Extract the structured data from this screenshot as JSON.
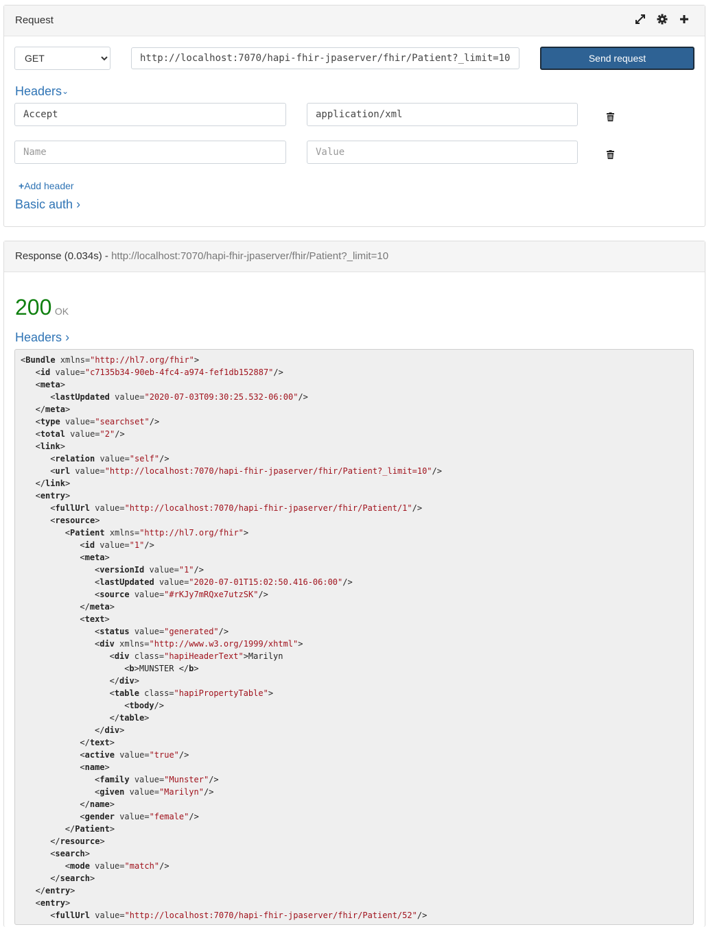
{
  "request": {
    "title": "Request",
    "method": "GET",
    "url": "http://localhost:7070/hapi-fhir-jpaserver/fhir/Patient?_limit=10",
    "send_label": "Send request",
    "headers_label": "Headers",
    "headers": [
      {
        "name": "Accept",
        "value": "application/xml"
      }
    ],
    "name_placeholder": "Name",
    "value_placeholder": "Value",
    "add_header_label": "Add header",
    "basic_auth_label": "Basic auth",
    "icons": [
      "expand-icon",
      "gear-icon",
      "plus-icon"
    ]
  },
  "response": {
    "title": "Response (0.034s) - ",
    "url": "http://localhost:7070/hapi-fhir-jpaserver/fhir/Patient?_limit=10",
    "status_code": "200",
    "status_text": "OK",
    "headers_label": "Headers",
    "status_color": "#108010",
    "body_lines": [
      [
        0,
        "Bundle",
        [
          [
            "xmlns",
            "http://hl7.org/fhir"
          ]
        ],
        "open",
        ""
      ],
      [
        1,
        "id",
        [
          [
            "value",
            "c7135b34-90eb-4fc4-a974-fef1db152887"
          ]
        ],
        "self",
        ""
      ],
      [
        1,
        "meta",
        [],
        "open",
        ""
      ],
      [
        2,
        "lastUpdated",
        [
          [
            "value",
            "2020-07-03T09:30:25.532-06:00"
          ]
        ],
        "self",
        ""
      ],
      [
        1,
        "meta",
        [],
        "close",
        ""
      ],
      [
        1,
        "type",
        [
          [
            "value",
            "searchset"
          ]
        ],
        "self",
        ""
      ],
      [
        1,
        "total",
        [
          [
            "value",
            "2"
          ]
        ],
        "self",
        ""
      ],
      [
        1,
        "link",
        [],
        "open",
        ""
      ],
      [
        2,
        "relation",
        [
          [
            "value",
            "self"
          ]
        ],
        "self",
        ""
      ],
      [
        2,
        "url",
        [
          [
            "value",
            "http://localhost:7070/hapi-fhir-jpaserver/fhir/Patient?_limit=10"
          ]
        ],
        "self",
        ""
      ],
      [
        1,
        "link",
        [],
        "close",
        ""
      ],
      [
        1,
        "entry",
        [],
        "open",
        ""
      ],
      [
        2,
        "fullUrl",
        [
          [
            "value",
            "http://localhost:7070/hapi-fhir-jpaserver/fhir/Patient/1"
          ]
        ],
        "self",
        ""
      ],
      [
        2,
        "resource",
        [],
        "open",
        ""
      ],
      [
        3,
        "Patient",
        [
          [
            "xmlns",
            "http://hl7.org/fhir"
          ]
        ],
        "open",
        ""
      ],
      [
        4,
        "id",
        [
          [
            "value",
            "1"
          ]
        ],
        "self",
        ""
      ],
      [
        4,
        "meta",
        [],
        "open",
        ""
      ],
      [
        5,
        "versionId",
        [
          [
            "value",
            "1"
          ]
        ],
        "self",
        ""
      ],
      [
        5,
        "lastUpdated",
        [
          [
            "value",
            "2020-07-01T15:02:50.416-06:00"
          ]
        ],
        "self",
        ""
      ],
      [
        5,
        "source",
        [
          [
            "value",
            "#rKJy7mRQxe7utzSK"
          ]
        ],
        "self",
        ""
      ],
      [
        4,
        "meta",
        [],
        "close",
        ""
      ],
      [
        4,
        "text",
        [],
        "open",
        ""
      ],
      [
        5,
        "status",
        [
          [
            "value",
            "generated"
          ]
        ],
        "self",
        ""
      ],
      [
        5,
        "div",
        [
          [
            "xmlns",
            "http://www.w3.org/1999/xhtml"
          ]
        ],
        "open",
        ""
      ],
      [
        6,
        "div",
        [
          [
            "class",
            "hapiHeaderText"
          ]
        ],
        "open",
        "Marilyn"
      ],
      [
        7,
        "b",
        [],
        "inline",
        "MUNSTER "
      ],
      [
        6,
        "div",
        [],
        "close",
        ""
      ],
      [
        6,
        "table",
        [
          [
            "class",
            "hapiPropertyTable"
          ]
        ],
        "open",
        ""
      ],
      [
        7,
        "tbody",
        [],
        "self",
        ""
      ],
      [
        6,
        "table",
        [],
        "close",
        ""
      ],
      [
        5,
        "div",
        [],
        "close",
        ""
      ],
      [
        4,
        "text",
        [],
        "close",
        ""
      ],
      [
        4,
        "active",
        [
          [
            "value",
            "true"
          ]
        ],
        "self",
        ""
      ],
      [
        4,
        "name",
        [],
        "open",
        ""
      ],
      [
        5,
        "family",
        [
          [
            "value",
            "Munster"
          ]
        ],
        "self",
        ""
      ],
      [
        5,
        "given",
        [
          [
            "value",
            "Marilyn"
          ]
        ],
        "self",
        ""
      ],
      [
        4,
        "name",
        [],
        "close",
        ""
      ],
      [
        4,
        "gender",
        [
          [
            "value",
            "female"
          ]
        ],
        "self",
        ""
      ],
      [
        3,
        "Patient",
        [],
        "close",
        ""
      ],
      [
        2,
        "resource",
        [],
        "close",
        ""
      ],
      [
        2,
        "search",
        [],
        "open",
        ""
      ],
      [
        3,
        "mode",
        [
          [
            "value",
            "match"
          ]
        ],
        "self",
        ""
      ],
      [
        2,
        "search",
        [],
        "close",
        ""
      ],
      [
        1,
        "entry",
        [],
        "close",
        ""
      ],
      [
        1,
        "entry",
        [],
        "open",
        ""
      ],
      [
        2,
        "fullUrl",
        [
          [
            "value",
            "http://localhost:7070/hapi-fhir-jpaserver/fhir/Patient/52"
          ]
        ],
        "self",
        ""
      ]
    ]
  }
}
